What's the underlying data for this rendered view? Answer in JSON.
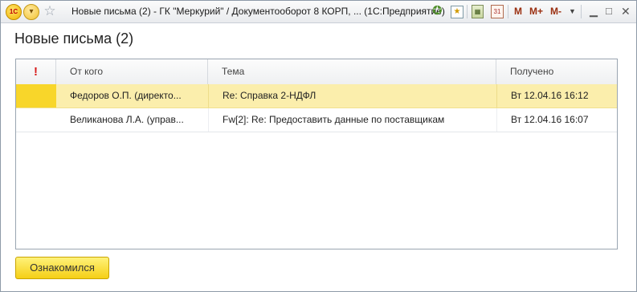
{
  "window": {
    "title": "Новые письма (2) - ГК \"Меркурий\" / Документооборот 8 КОРП, ...  (1С:Предприятие)",
    "logo_text": "1С",
    "menu_glyph": "▾",
    "fav_glyph": "☆",
    "tools": {
      "nav_glyph": "✪",
      "fav_glyph": "★",
      "calc_glyph": "▦",
      "cal_glyph": "31",
      "m_label": "M",
      "m_plus_label": "M+",
      "m_minus_label": "M-",
      "dd_glyph": "▼",
      "min_glyph": "▁",
      "max_glyph": "□",
      "close_glyph": "✕"
    }
  },
  "page": {
    "title": "Новые письма (2)"
  },
  "table": {
    "columns": {
      "importance": "!",
      "from": "От кого",
      "subject": "Тема",
      "received": "Получено"
    },
    "rows": [
      {
        "from": "Федоров О.П. (директо...",
        "subject": "Re: Справка 2-НДФЛ",
        "received": "Вт 12.04.16 16:12",
        "selected": true
      },
      {
        "from": "Великанова Л.А. (управ...",
        "subject": "Fw[2]: Re: Предоставить данные по поставщикам",
        "received": "Вт 12.04.16 16:07",
        "selected": false
      }
    ]
  },
  "actions": {
    "acknowledge_label": "Ознакомился"
  },
  "colors": {
    "selected_row": "#fbeeac",
    "marker": "#f8d62a",
    "button": "#f5cf16"
  }
}
